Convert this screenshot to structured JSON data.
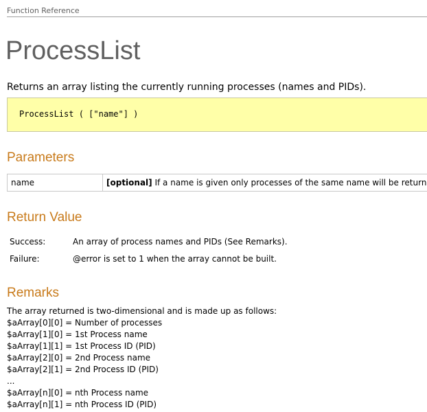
{
  "breadcrumb": "Function Reference",
  "title": "ProcessList",
  "description": "Returns an array listing the currently running processes (names and PIDs).",
  "syntax": "ProcessList ( [\"name\"] )",
  "sections": {
    "parameters": "Parameters",
    "return_value": "Return Value",
    "remarks": "Remarks"
  },
  "parameters": [
    {
      "name": "name",
      "optional_tag": "[optional]",
      "description": " If a name is given only processes of the same name will be returned."
    }
  ],
  "return_value": {
    "success_label": "Success:",
    "success_text": "An array of process names and PIDs (See Remarks).",
    "failure_label": "Failure:",
    "failure_text": "@error is set to 1 when the array cannot be built."
  },
  "remarks": [
    "The array returned is two-dimensional and is made up as follows:",
    "$aArray[0][0] = Number of processes",
    "$aArray[1][0] = 1st Process name",
    "$aArray[1][1] = 1st Process ID (PID)",
    "$aArray[2][0] = 2nd Process name",
    "$aArray[2][1] = 2nd Process ID (PID)",
    "...",
    "$aArray[n][0] = nth Process name",
    "$aArray[n][1] = nth Process ID (PID)"
  ],
  "colors": {
    "heading": "#c87a1a",
    "title": "#606060",
    "syntax_background": "#ffffa8"
  }
}
